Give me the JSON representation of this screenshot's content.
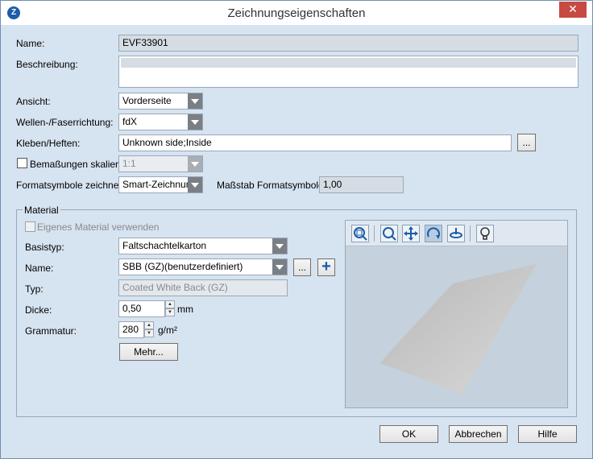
{
  "window": {
    "title": "Zeichnungseigenschaften",
    "close_symbol": "✕"
  },
  "form": {
    "name_label": "Name:",
    "name_value": "EVF33901",
    "beschreibung_label": "Beschreibung:",
    "ansicht_label": "Ansicht:",
    "ansicht_value": "Vorderseite",
    "wellen_label": "Wellen-/Faserrichtung:",
    "wellen_value": "fdX",
    "kleben_label": "Kleben/Heften:",
    "kleben_value": "Unknown side;Inside",
    "kleben_button": "...",
    "bemassungen_label": "Bemaßungen skalieren",
    "bemassungen_value": "1:1",
    "formatsymbole_label": "Formatsymbole zeichnen:",
    "formatsymbole_value": "Smart-Zeichnung",
    "massstab_label": "Maßstab Formatsymbole:",
    "massstab_value": "1,00"
  },
  "material": {
    "group_title": "Material",
    "eigenes_label": "Eigenes Material verwenden",
    "basistyp_label": "Basistyp:",
    "basistyp_value": "Faltschachtelkarton",
    "name_label": "Name:",
    "name_value": "SBB (GZ)(benutzerdefiniert)",
    "name_button": "...",
    "add_symbol": "+",
    "typ_label": "Typ:",
    "typ_value": "Coated White Back (GZ)",
    "dicke_label": "Dicke:",
    "dicke_value": "0,50",
    "dicke_unit": "mm",
    "grammatur_label": "Grammatur:",
    "grammatur_value": "280",
    "grammatur_unit": "g/m²",
    "mehr_button": "Mehr..."
  },
  "viewer_tools": [
    "zoom-fit-icon",
    "zoom-icon",
    "pan-icon",
    "rotate-icon",
    "orbit-icon",
    "light-bulb-icon"
  ],
  "buttons": {
    "ok": "OK",
    "cancel": "Abbrechen",
    "help": "Hilfe"
  },
  "colors": {
    "window_bg": "#d6e3f0",
    "close_bg": "#c74a42",
    "accent": "#1c5ca8"
  }
}
